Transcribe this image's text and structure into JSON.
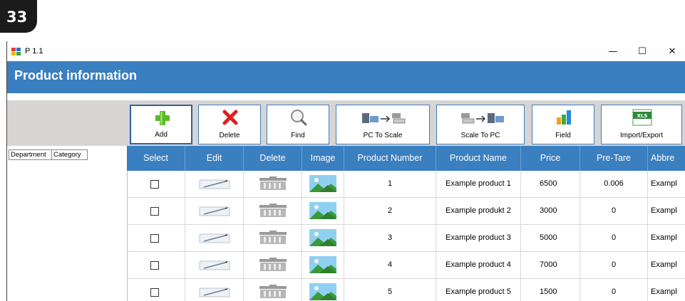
{
  "step_badge": "33",
  "window": {
    "title": "P 1.1",
    "minimize_glyph": "—",
    "maximize_glyph": "☐",
    "close_glyph": "✕"
  },
  "header": {
    "title": "Product information"
  },
  "toolbar": [
    {
      "label": "Add",
      "icon": "add-icon"
    },
    {
      "label": "Delete",
      "icon": "delete-icon"
    },
    {
      "label": "Find",
      "icon": "find-icon"
    },
    {
      "label": "PC To Scale",
      "icon": "pc-to-scale-icon"
    },
    {
      "label": "Scale To PC",
      "icon": "scale-to-pc-icon"
    },
    {
      "label": "Field",
      "icon": "field-chart-icon"
    },
    {
      "label": "Import/Export",
      "icon": "xls-icon",
      "icon_text": "XLS"
    }
  ],
  "left_tabs": [
    "Department",
    "Category"
  ],
  "grid": {
    "columns": [
      "Select",
      "Edit",
      "Delete",
      "Image",
      "Product Number",
      "Product Name",
      "Price",
      "Pre-Tare",
      "Abbre"
    ],
    "rows": [
      {
        "number": "1",
        "name": "Example product 1",
        "price": "6500",
        "pretare": "0.006",
        "abbr": "Exampl"
      },
      {
        "number": "2",
        "name": "Example produkt 2",
        "price": "3000",
        "pretare": "0",
        "abbr": "Exampl"
      },
      {
        "number": "3",
        "name": "Example product 3",
        "price": "5000",
        "pretare": "0",
        "abbr": "Exampl"
      },
      {
        "number": "4",
        "name": "Example product 4",
        "price": "7000",
        "pretare": "0",
        "abbr": "Exampl"
      },
      {
        "number": "5",
        "name": "Example product 5",
        "price": "1500",
        "pretare": "0",
        "abbr": "Exampl"
      }
    ]
  },
  "colors": {
    "header_blue": "#3a7fbf",
    "add_green": "#5cb82e",
    "delete_red": "#e02020"
  }
}
